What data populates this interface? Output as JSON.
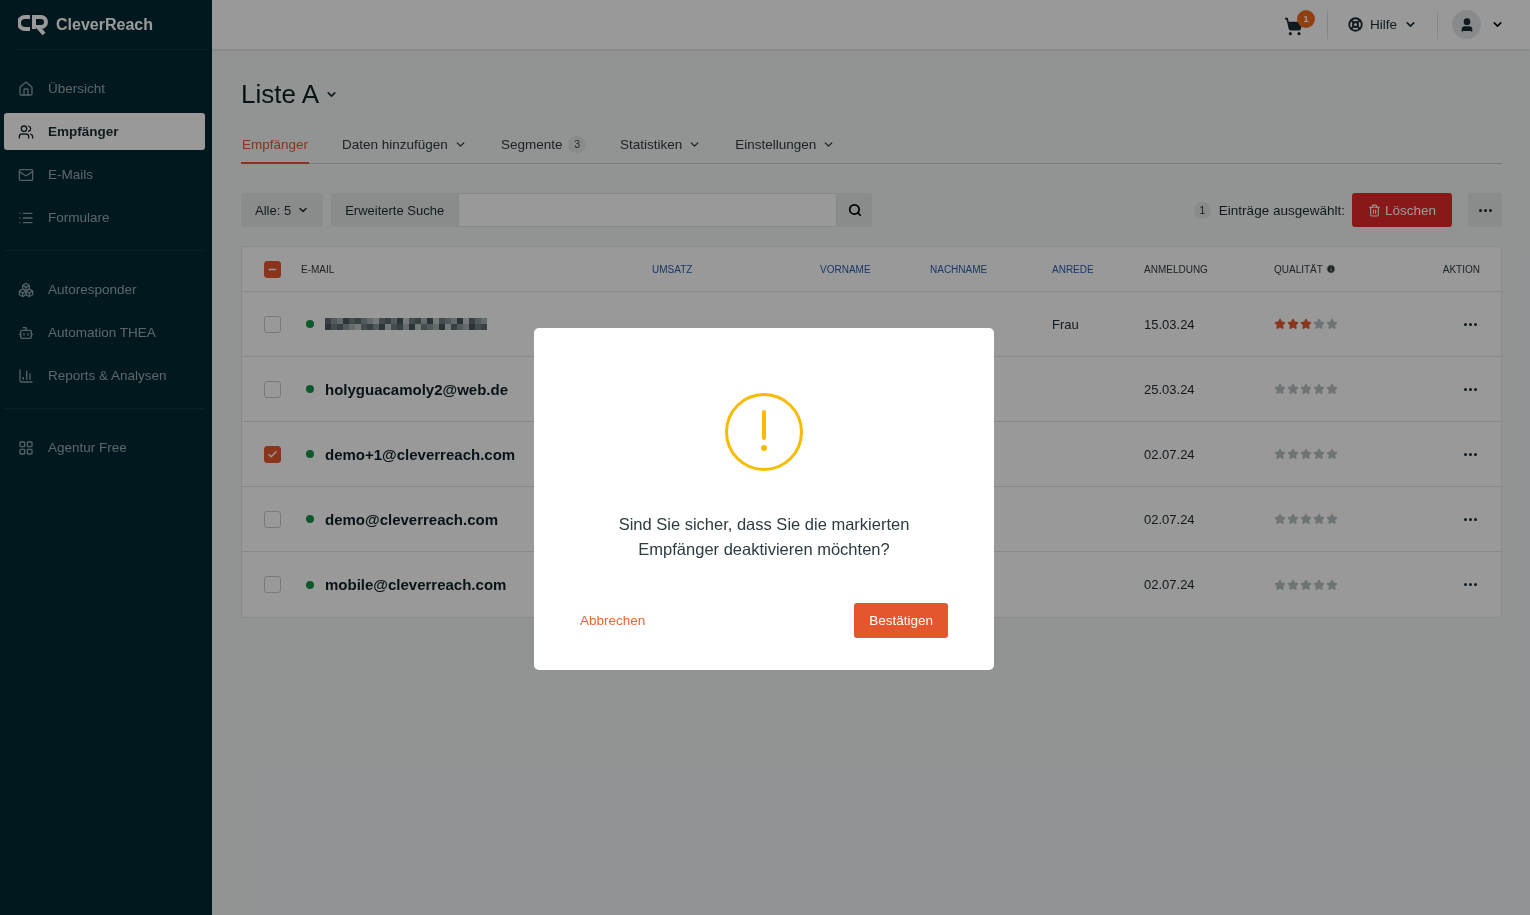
{
  "sidebar": {
    "brand": "CleverReach",
    "groups": [
      [
        {
          "label": "Übersicht",
          "selected": false
        },
        {
          "label": "Empfänger",
          "selected": true
        },
        {
          "label": "E-Mails",
          "selected": false
        },
        {
          "label": "Formulare",
          "selected": false
        }
      ],
      [
        {
          "label": "Autoresponder",
          "selected": false
        },
        {
          "label": "Automation THEA",
          "selected": false
        },
        {
          "label": "Reports & Analysen",
          "selected": false
        }
      ],
      [
        {
          "label": "Agentur Free",
          "selected": false
        }
      ]
    ]
  },
  "topbar": {
    "cart_badge": "1",
    "help": "Hilfe"
  },
  "page": {
    "title": "Liste A"
  },
  "tabs": [
    {
      "label": "Empfänger",
      "selected": true,
      "dropdown": false
    },
    {
      "label": "Daten hinzufügen",
      "selected": false,
      "dropdown": true
    },
    {
      "label": "Segmente",
      "selected": false,
      "dropdown": false,
      "count": "3"
    },
    {
      "label": "Statistiken",
      "selected": false,
      "dropdown": true
    },
    {
      "label": "Einstellungen",
      "selected": false,
      "dropdown": true
    }
  ],
  "toolbar": {
    "filter": "Alle: 5",
    "advanced_search": "Erweiterte Suche",
    "selected_count": "1",
    "selected_label": "Einträge ausgewählt:",
    "delete": "Löschen"
  },
  "table": {
    "select_all_partial": true,
    "columns": [
      {
        "label": "E-MAIL",
        "sortable": false
      },
      {
        "label": "UMSATZ",
        "sortable": true
      },
      {
        "label": "VORNAME",
        "sortable": true
      },
      {
        "label": "NACHNAME",
        "sortable": true
      },
      {
        "label": "ANREDE",
        "sortable": true
      },
      {
        "label": "ANMELDUNG",
        "sortable": false
      },
      {
        "label": "QUALITÄT",
        "sortable": false,
        "info": true
      },
      {
        "label": "AKTION",
        "sortable": false
      }
    ],
    "rows": [
      {
        "checked": false,
        "redacted": true,
        "anrede": "Frau",
        "anmeldung": "15.03.24",
        "stars": 3
      },
      {
        "checked": false,
        "email": "holyguacamoly2@web.de",
        "anmeldung": "25.03.24",
        "stars": 0
      },
      {
        "checked": true,
        "email": "demo+1@cleverreach.com",
        "anmeldung": "02.07.24",
        "stars": 0
      },
      {
        "checked": false,
        "email": "demo@cleverreach.com",
        "anmeldung": "02.07.24",
        "stars": 0
      },
      {
        "checked": false,
        "email": "mobile@cleverreach.com",
        "anmeldung": "02.07.24",
        "stars": 0
      }
    ]
  },
  "dialog": {
    "message": "Sind Sie sicher, dass Sie die markierten Empfänger deaktivieren möchten?",
    "cancel": "Abbrechen",
    "confirm": "Bestätigen"
  }
}
